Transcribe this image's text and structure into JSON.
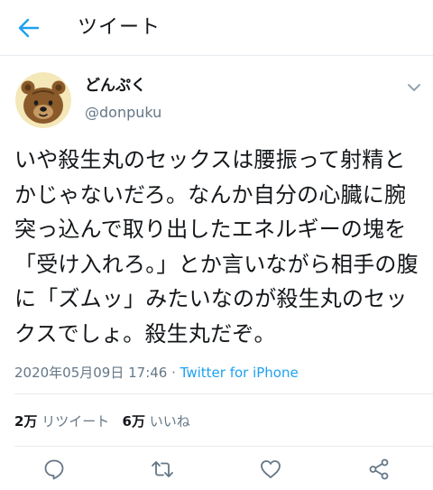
{
  "header": {
    "title": "ツイート",
    "back_icon": "arrow-left-icon"
  },
  "user": {
    "display_name": "どんぷく",
    "handle": "@donpuku",
    "avatar": "bear-avatar"
  },
  "tweet": {
    "text": "いや殺生丸のセックスは腰振って射精とかじゃないだろ。なんか自分の心臓に腕突っ込んで取り出したエネルギーの塊を「受け入れろ。」とか言いながら相手の腹に「ズムッ」みたいなのが殺生丸のセックスでしょ。殺生丸だぞ。",
    "timestamp": "2020年05月09日 17:46",
    "separator": " · ",
    "source": "Twitter for iPhone"
  },
  "stats": {
    "retweets_count": "2万",
    "retweets_label": "リツイート",
    "likes_count": "6万",
    "likes_label": "いいね"
  },
  "actions": [
    "reply-icon",
    "retweet-icon",
    "like-icon",
    "share-icon"
  ],
  "colors": {
    "accent": "#1da1f2",
    "secondary_text": "#657786",
    "divider": "#e6ecf0",
    "action_icon": "#657786"
  }
}
